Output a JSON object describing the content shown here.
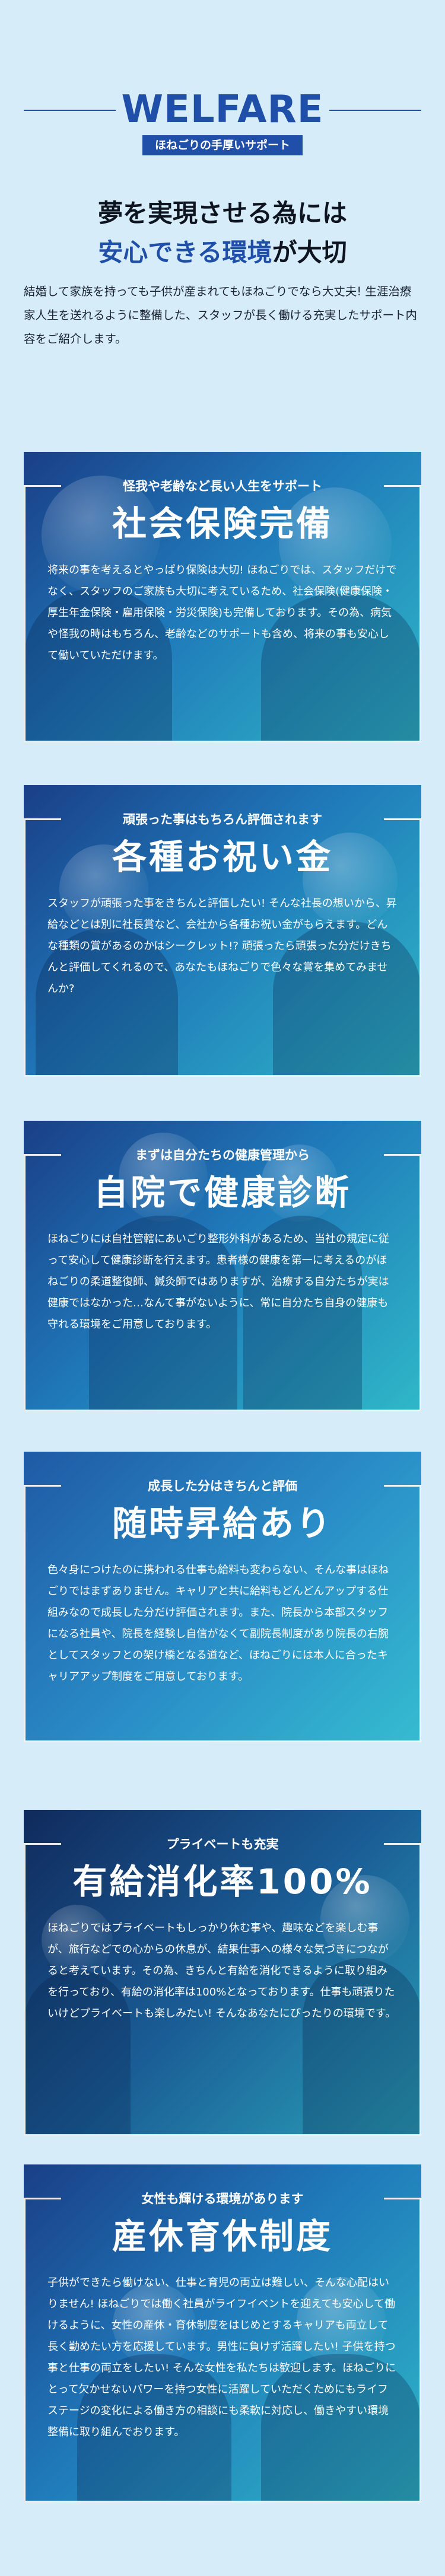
{
  "header": {
    "title": "WELFARE",
    "subtitle": "ほねごりの手厚いサポート"
  },
  "headline": {
    "line1": "夢を実現させる為には",
    "line2_accent": "安心できる環境",
    "line2_rest": "が大切"
  },
  "intro": "結婚して家族を持っても子供が産まれてもほねごりでなら大丈夫! 生涯治療家人生を送れるように整備した、スタッフが長く働ける充実したサポート内容をご紹介します。",
  "cards": [
    {
      "kicker": "怪我や老齢など長い人生をサポート",
      "heading": "社会保険完備",
      "body": "将来の事を考えるとやっぱり保険は大切! ほねごりでは、スタッフだけでなく、スタッフのご家族も大切に考えているため、社会保険(健康保険・厚生年金保険・雇用保険・労災保険)も完備しております。その為、病気や怪我の時はもちろん、老齢などのサポートも含め、将来の事も安心して働いていただけます。"
    },
    {
      "kicker": "頑張った事はもちろん評価されます",
      "heading": "各種お祝い金",
      "body": "スタッフが頑張った事をきちんと評価したい! そんな社長の想いから、昇給などとは別に社長賞など、会社から各種お祝い金がもらえます。どんな種類の賞があるのかはシークレット!? 頑張ったら頑張った分だけきちんと評価してくれるので、あなたもほねごりで色々な賞を集めてみませんか?"
    },
    {
      "kicker": "まずは自分たちの健康管理から",
      "heading": "自院で健康診断",
      "body": "ほねごりには自社管轄にあいごり整形外科があるため、当社の規定に従って安心して健康診断を行えます。患者様の健康を第一に考えるのがほねごりの柔道整復師、鍼灸師ではありますが、治療する自分たちが実は健康ではなかった…なんて事がないように、常に自分たち自身の健康も守れる環境をご用意しております。"
    },
    {
      "kicker": "成長した分はきちんと評価",
      "heading": "随時昇給あり",
      "body": "色々身につけたのに携われる仕事も給料も変わらない、そんな事はほねごりではまずありません。キャリアと共に給料もどんどんアップする仕組みなので成長した分だけ評価されます。また、院長から本部スタッフになる社員や、院長を経験し自信がなくて副院長制度があり院長の右腕としてスタッフとの架け橋となる道など、ほねごりには本人に合ったキャリアアップ制度をご用意しております。"
    },
    {
      "kicker": "プライベートも充実",
      "heading": "有給消化率100%",
      "body": "ほねごりではプライベートもしっかり休む事や、趣味などを楽しむ事が、旅行などでの心からの休息が、結果仕事への様々な気づきにつながると考えています。その為、きちんと有給を消化できるように取り組みを行っており、有給の消化率は100%となっております。仕事も頑張りたいけどプライベートも楽しみたい! そんなあなたにぴったりの環境です。"
    },
    {
      "kicker": "女性も輝ける環境があります",
      "heading": "産休育休制度",
      "body": "子供ができたら働けない、仕事と育児の両立は難しい、そんな心配はいりません! ほねごりでは働く社員がライフイベントを迎えても安心して働けるように、女性の産休・育休制度をはじめとするキャリアも両立して長く勤めたい方を応援しています。男性に負けず活躍したい! 子供を持つ事と仕事の両立をしたい! そんな女性を私たちは歓迎します。ほねごりにとって欠かせないパワーを持つ女性に活躍していただくためにもライフステージの変化による働き方の相談にも柔軟に対応し、働きやすい環境整備に取り組んでおります。"
    }
  ]
}
